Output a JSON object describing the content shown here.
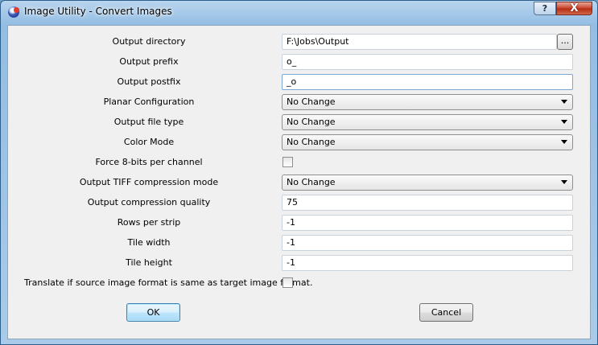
{
  "window": {
    "title": "Image Utility - Convert Images",
    "help_label": "?",
    "close_label": "X"
  },
  "form": {
    "output_directory": {
      "label": "Output directory",
      "value": "F:\\Jobs\\Output",
      "browse_label": "..."
    },
    "output_prefix": {
      "label": "Output prefix",
      "value": "o_"
    },
    "output_postfix": {
      "label": "Output postfix",
      "value": "_o"
    },
    "planar_configuration": {
      "label": "Planar Configuration",
      "value": "No Change"
    },
    "output_file_type": {
      "label": "Output file type",
      "value": "No Change"
    },
    "color_mode": {
      "label": "Color Mode",
      "value": "No Change"
    },
    "force_8bits": {
      "label": "Force 8-bits per channel",
      "checked": false
    },
    "tiff_compression": {
      "label": "Output TIFF compression mode",
      "value": "No Change"
    },
    "compression_quality": {
      "label": "Output compression quality",
      "value": "75"
    },
    "rows_per_strip": {
      "label": "Rows per strip",
      "value": "-1"
    },
    "tile_width": {
      "label": "Tile width",
      "value": "-1"
    },
    "tile_height": {
      "label": "Tile height",
      "value": "-1"
    },
    "translate_same_format": {
      "label": "Translate if source image format is same as target image format.",
      "checked": false
    }
  },
  "buttons": {
    "ok_label": "OK",
    "cancel_label": "Cancel"
  }
}
